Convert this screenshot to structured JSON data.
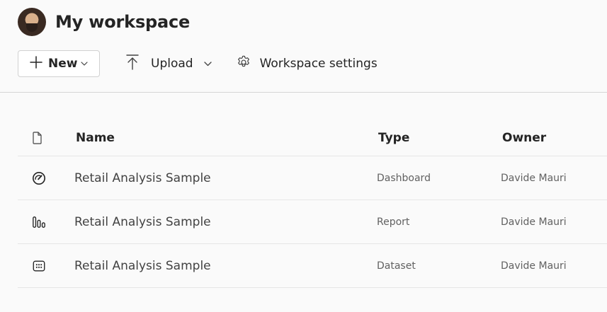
{
  "header": {
    "title": "My workspace"
  },
  "toolbar": {
    "new_label": "New",
    "upload_label": "Upload",
    "settings_label": "Workspace settings"
  },
  "table": {
    "columns": {
      "name": "Name",
      "type": "Type",
      "owner": "Owner"
    },
    "rows": [
      {
        "icon": "dashboard-icon",
        "name": "Retail Analysis Sample",
        "type": "Dashboard",
        "owner": "Davide Mauri"
      },
      {
        "icon": "report-icon",
        "name": "Retail Analysis Sample",
        "type": "Report",
        "owner": "Davide Mauri"
      },
      {
        "icon": "dataset-icon",
        "name": "Retail Analysis Sample",
        "type": "Dataset",
        "owner": "Davide Mauri"
      }
    ]
  }
}
